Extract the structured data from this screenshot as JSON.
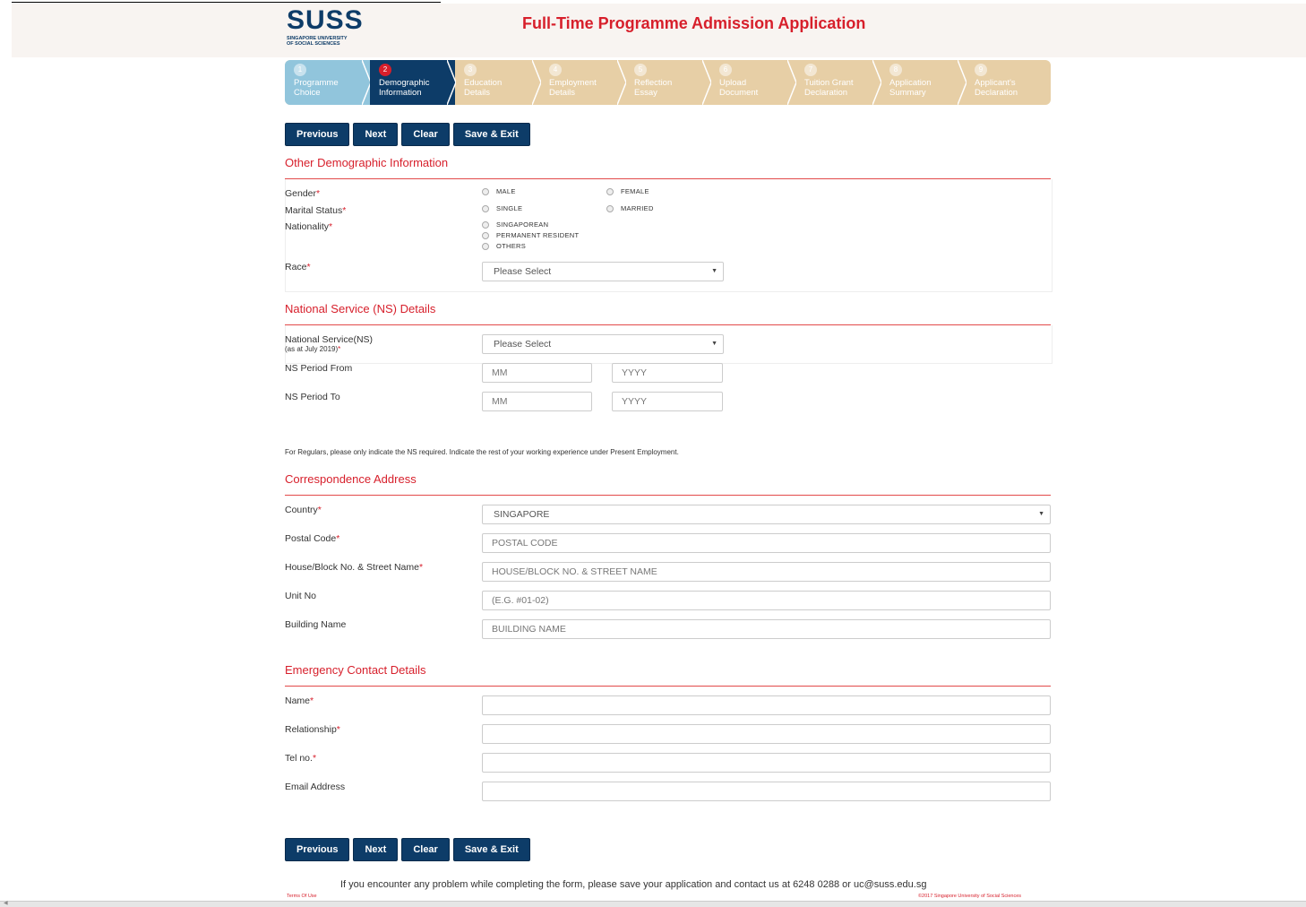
{
  "header": {
    "logo_text": "SUSS",
    "logo_sub_line1": "SINGAPORE UNIVERSITY",
    "logo_sub_line2": "OF SOCIAL SCIENCES",
    "title": "Full-Time Programme Admission Application"
  },
  "steps": [
    {
      "num": "1",
      "line1": "Programme",
      "line2": "Choice",
      "state": "done"
    },
    {
      "num": "2",
      "line1": "Demographic",
      "line2": "Information",
      "state": "active"
    },
    {
      "num": "3",
      "line1": "Education",
      "line2": "Details",
      "state": "future"
    },
    {
      "num": "4",
      "line1": "Employment",
      "line2": "Details",
      "state": "future"
    },
    {
      "num": "5",
      "line1": "Reflection",
      "line2": "Essay",
      "state": "future"
    },
    {
      "num": "6",
      "line1": "Upload",
      "line2": "Document",
      "state": "future"
    },
    {
      "num": "7",
      "line1": "Tuition Grant",
      "line2": "Declaration",
      "state": "future"
    },
    {
      "num": "8",
      "line1": "Application",
      "line2": "Summary",
      "state": "future"
    },
    {
      "num": "9",
      "line1": "Applicant's",
      "line2": "Declaration",
      "state": "future"
    }
  ],
  "buttons": {
    "previous": "Previous",
    "next": "Next",
    "clear": "Clear",
    "save_exit": "Save & Exit"
  },
  "demographic": {
    "title": "Other Demographic Information",
    "gender_label": "Gender",
    "gender_options": [
      "MALE",
      "FEMALE"
    ],
    "marital_label": "Marital Status",
    "marital_options": [
      "SINGLE",
      "MARRIED"
    ],
    "nationality_label": "Nationality",
    "nationality_options": [
      "SINGAPOREAN",
      "PERMANENT RESIDENT",
      "OTHERS"
    ],
    "race_label": "Race",
    "race_value": "Please Select"
  },
  "ns": {
    "title": "National Service (NS) Details",
    "ns_label": "National Service(NS)",
    "ns_sub": "(as at July 2019)",
    "ns_value": "Please Select",
    "from_label": "NS Period From",
    "to_label": "NS Period To",
    "mm_placeholder": "MM",
    "yyyy_placeholder": "YYYY",
    "note": "For Regulars, please only indicate the NS required. Indicate the rest of your working experience under Present Employment."
  },
  "address": {
    "title": "Correspondence Address",
    "country_label": "Country",
    "country_value": "SINGAPORE",
    "postal_label": "Postal Code",
    "postal_placeholder": "POSTAL CODE",
    "street_label": "House/Block No. & Street Name",
    "street_placeholder": "HOUSE/BLOCK NO. & STREET NAME",
    "unit_label": "Unit No",
    "unit_placeholder": "(E.G. #01-02)",
    "building_label": "Building Name",
    "building_placeholder": "BUILDING NAME"
  },
  "emergency": {
    "title": "Emergency Contact Details",
    "name_label": "Name",
    "relationship_label": "Relationship",
    "tel_label": "Tel no.",
    "email_label": "Email Address"
  },
  "required_mark": "*",
  "footer": {
    "message": "If you encounter any problem while completing the form, please save your application and contact us at 6248 0288 or uc@suss.edu.sg",
    "terms": "Terms Of Use",
    "copyright": "©2017 Singapore University of Social Sciences"
  },
  "colors": {
    "brand_navy": "#0d3c68",
    "brand_red": "#d71f2b",
    "step_done": "#91c5dc",
    "step_future": "#e7cfa6"
  }
}
